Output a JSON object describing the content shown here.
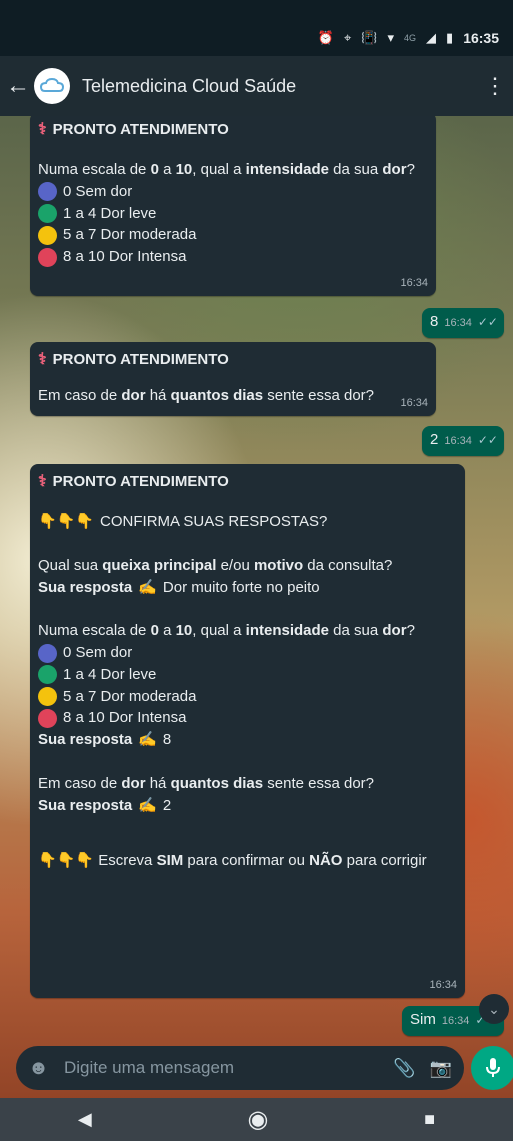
{
  "status_bar": {
    "net": "4G",
    "time": "16:35"
  },
  "header": {
    "back_icon": "arrow-left-icon",
    "title": "Telemedicina Cloud Saúde",
    "menu_icon": "more-vert-icon"
  },
  "common": {
    "header": "PRONTO ATENDIMENTO",
    "your_answer": "Sua resposta"
  },
  "messages": {
    "m1": {
      "q_a": "Numa escala de ",
      "q_b": "0",
      "q_c": " a ",
      "q_d": "10",
      "q_e": ", qual a ",
      "q_f": "intensidade",
      "q_g": " da sua ",
      "q_h": "dor",
      "q_i": "?",
      "options": [
        "0 Sem dor",
        "1 a 4 Dor leve",
        "5 a 7 Dor moderada",
        "8 a 10 Dor Intensa"
      ],
      "time": "16:34"
    },
    "r1": {
      "text": "8",
      "time": "16:34"
    },
    "m2": {
      "a": "Em caso de ",
      "b": "dor",
      "c": " há ",
      "d": "quantos dias",
      "e": " sente essa dor?",
      "time": "16:34"
    },
    "r2": {
      "text": "2",
      "time": "16:34"
    },
    "m3": {
      "confirm": "CONFIRMA SUAS RESPOSTAS?",
      "q1_a": "Qual sua ",
      "q1_b": "queixa principal",
      "q1_c": " e/ou ",
      "q1_d": "motivo",
      "q1_e": " da consulta?",
      "q1_answer": "Dor muito forte no peito",
      "q2_answer": "8",
      "q3_answer": "2",
      "final_a": "Escreva ",
      "final_b": "SIM",
      "final_c": " para confirmar ou ",
      "final_d": "NÃO",
      "final_e": " para corrigir",
      "time": "16:34"
    },
    "r3": {
      "text": "Sim",
      "time": "16:34"
    }
  },
  "composer": {
    "placeholder": "Digite uma mensagem"
  },
  "colors": {
    "blue": "#5865c8",
    "green": "#1aa36a",
    "yellow": "#f4c20d",
    "red": "#e0435a",
    "accent": "#00a884"
  }
}
